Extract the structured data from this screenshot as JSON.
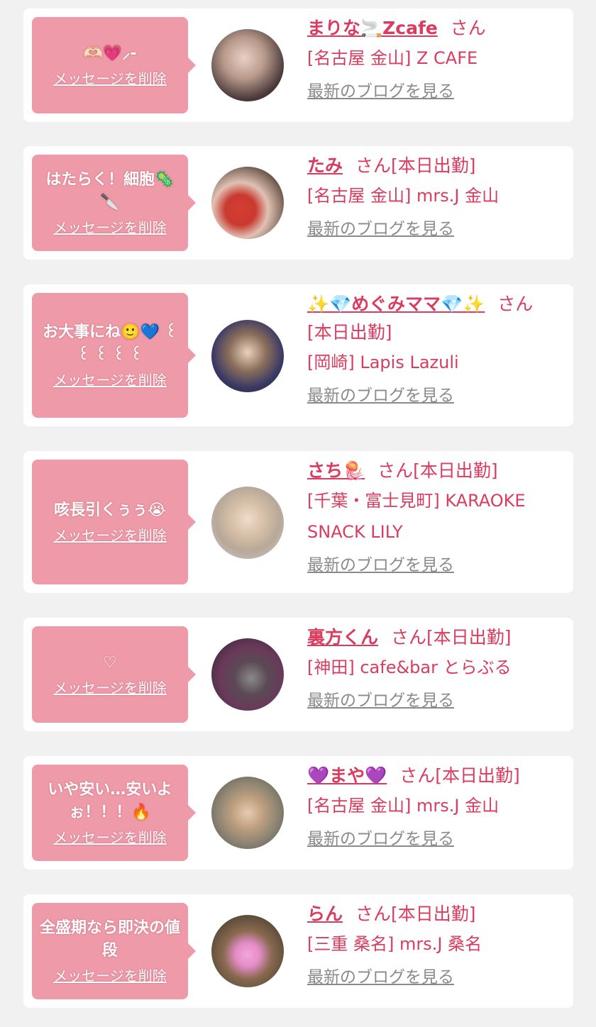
{
  "common": {
    "delete_label": "メッセージを削除",
    "blog_label": "最新のブログを見る",
    "san": "さん",
    "today": "[本日出勤]"
  },
  "items": [
    {
      "message": "🫶🏻💗⸝-",
      "name": "まりな🚬Zcafe",
      "tag": "",
      "shop": "[名古屋 金山] Z CAFE"
    },
    {
      "message": "はたらく！細胞🦠🔪",
      "name": "たみ",
      "tag": "[本日出勤]",
      "shop": "[名古屋 金山] mrs.J 金山"
    },
    {
      "message": "お大事にね🙂💙 ꒰ ꒰ ꒰ ꒰ ꒰",
      "name": "✨💎めぐみママ💎✨",
      "tag": "[本日出勤]",
      "shop": "[岡崎] Lapis Lazuli"
    },
    {
      "message": "咳長引くぅぅ😭",
      "name": "さち🪼",
      "tag": "[本日出勤]",
      "shop": "[千葉・富士見町] KARAOKE SNACK LILY"
    },
    {
      "message": "♡",
      "name": "裏方くん",
      "tag": "[本日出勤]",
      "shop": "[神田] cafe&bar とらぶる"
    },
    {
      "message": "いや安い…安いよぉ！！！🔥",
      "name": "💜まや💜",
      "tag": "[本日出勤]",
      "shop": "[名古屋 金山] mrs.J 金山"
    },
    {
      "message": "全盛期なら即決の値段",
      "name": "らん",
      "tag": "[本日出勤]",
      "shop": "[三重 桑名] mrs.J 桑名"
    }
  ],
  "colors": {
    "accent": "#d93c5e",
    "bubble": "#ef9aa8",
    "link_gray": "#8a8a8a",
    "background": "#f1f1f1"
  }
}
